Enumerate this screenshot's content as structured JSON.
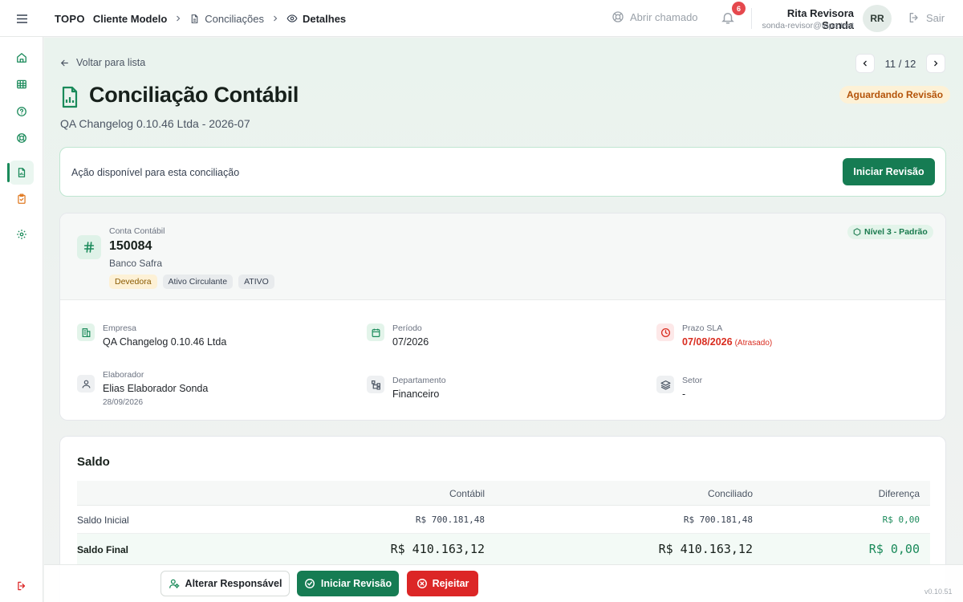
{
  "colors": {
    "accent": "#167c53",
    "accent_soft": "#dff2e8",
    "danger": "#dc2626",
    "warning_bg": "#fdf1d6",
    "warning_text": "#b45309",
    "late": "#d92d20"
  },
  "sidebar": {
    "items": [
      {
        "icon": "home-icon"
      },
      {
        "icon": "table-icon"
      },
      {
        "icon": "help-circle-icon"
      },
      {
        "icon": "life-buoy-icon"
      },
      {
        "icon": "file-chart-icon",
        "active": true
      },
      {
        "icon": "clipboard-check-icon"
      },
      {
        "icon": "settings-icon"
      }
    ],
    "logout_icon": "logout-icon"
  },
  "header": {
    "brand": "TOPO",
    "client": "Cliente Modelo",
    "breadcrumb_reconciliations": "Conciliações",
    "breadcrumb_details": "Detalhes",
    "open_ticket": "Abrir chamado",
    "notifications_count": "6",
    "user_name": "Rita Revisora Sonda",
    "user_email": "sonda-revisor@topo.test",
    "user_initials": "RR",
    "logout": "Sair"
  },
  "page": {
    "back_link": "Voltar para lista",
    "pager": "11 / 12",
    "title": "Conciliação Contábil",
    "subtitle": "QA Changelog 0.10.46 Ltda - 2026-07",
    "status": "Aguardando Revisão"
  },
  "action_panel": {
    "text": "Ação disponível para esta conciliação",
    "button": "Iniciar Revisão"
  },
  "account": {
    "label": "Conta Contábil",
    "number": "150084",
    "name": "Banco Safra",
    "tags": [
      "Devedora",
      "Ativo Circulante",
      "ATIVO"
    ],
    "level": "Nível 3 - Padrão"
  },
  "details": {
    "empresa_label": "Empresa",
    "empresa_value": "QA Changelog 0.10.46 Ltda",
    "periodo_label": "Período",
    "periodo_value": "07/2026",
    "prazo_label": "Prazo SLA",
    "prazo_value": "07/08/2026",
    "prazo_status": "(Atrasado)",
    "elaborador_label": "Elaborador",
    "elaborador_value": "Elias Elaborador Sonda",
    "elaborador_date": "28/09/2026",
    "departamento_label": "Departamento",
    "departamento_value": "Financeiro",
    "setor_label": "Setor",
    "setor_value": "-"
  },
  "saldo": {
    "title": "Saldo",
    "columns": [
      "Contábil",
      "Conciliado",
      "Diferença"
    ],
    "rows": [
      {
        "label": "Saldo Inicial",
        "contabil": "R$ 700.181,48",
        "conciliado": "R$ 700.181,48",
        "diferenca": "R$ 0,00"
      },
      {
        "label": "Saldo Final",
        "contabil": "R$ 410.163,12",
        "conciliado": "R$ 410.163,12",
        "diferenca": "R$ 0,00"
      }
    ]
  },
  "bottom_bar": {
    "change_owner": "Alterar Responsável",
    "start_review": "Iniciar Revisão",
    "reject": "Rejeitar"
  },
  "version": "v0.10.51"
}
